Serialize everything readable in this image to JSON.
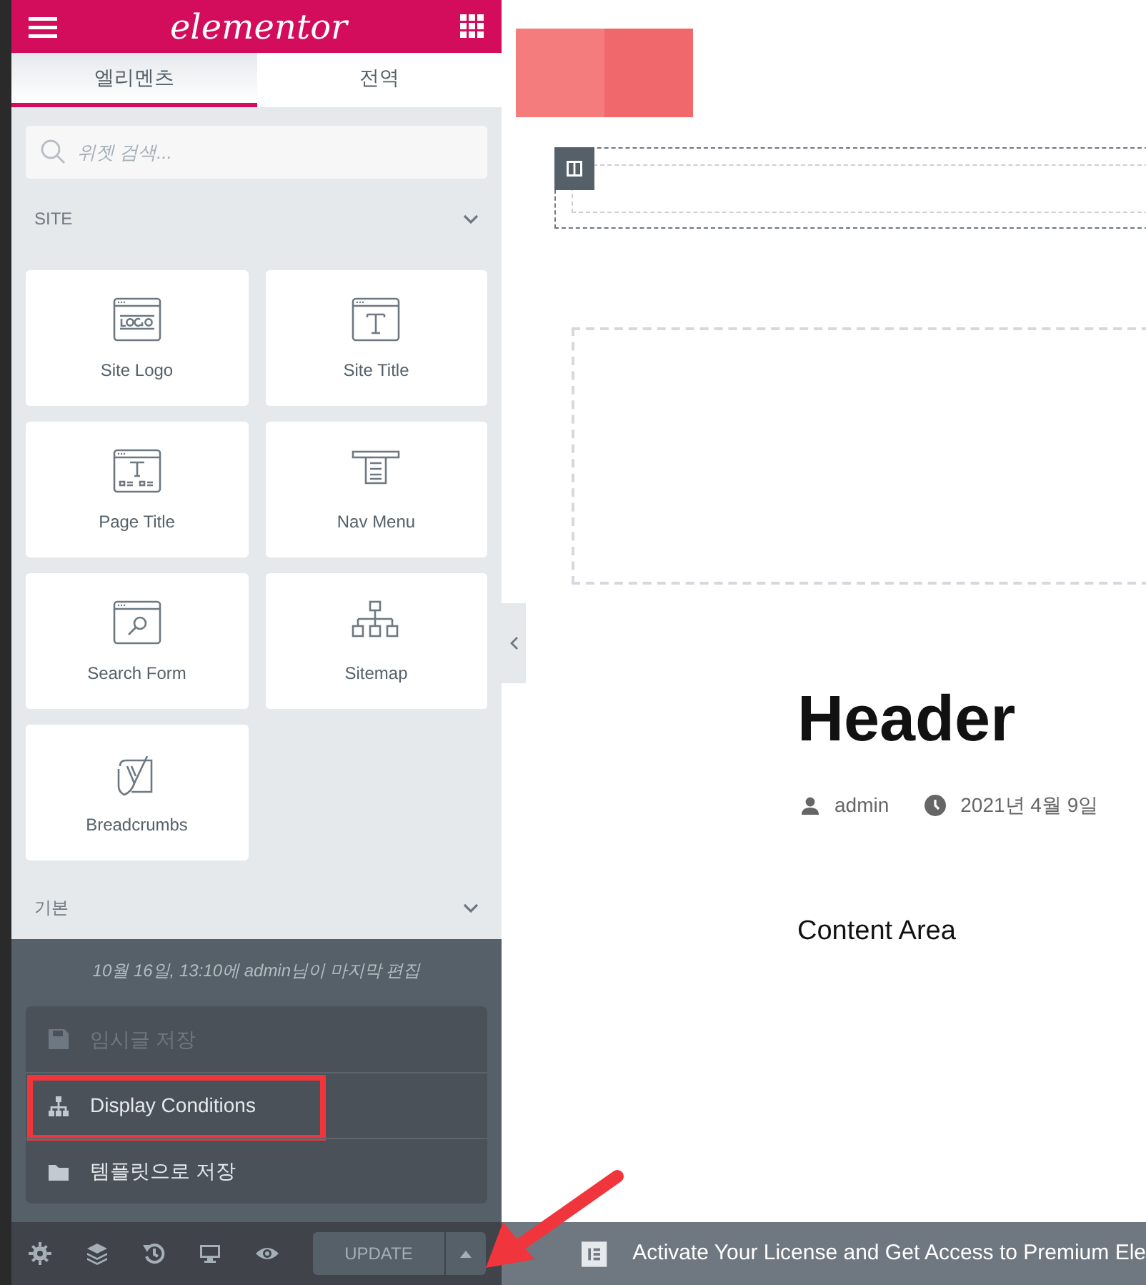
{
  "panel": {
    "logo": "elementor",
    "tabs": [
      {
        "label": "엘리멘츠",
        "selected": true
      },
      {
        "label": "전역",
        "selected": false
      }
    ],
    "search": {
      "placeholder": "위젯 검색..."
    },
    "categories": [
      {
        "title": "SITE",
        "widgets": [
          {
            "label": "Site Logo",
            "kind": "logo"
          },
          {
            "label": "Site Title",
            "kind": "title"
          },
          {
            "label": "Page Title",
            "kind": "page"
          },
          {
            "label": "Nav Menu",
            "kind": "nav"
          },
          {
            "label": "Search Form",
            "kind": "search"
          },
          {
            "label": "Sitemap",
            "kind": "sitemap"
          },
          {
            "label": "Breadcrumbs",
            "kind": "yoast"
          }
        ]
      },
      {
        "title": "기본"
      }
    ],
    "last_edited": "10월 16일, 13:10에 admin님이 마지막 편집",
    "save_menu": [
      {
        "label": "임시글 저장",
        "kind": "save",
        "disabled": true,
        "highlighted": false
      },
      {
        "label": "Display Conditions",
        "kind": "sitemap",
        "disabled": false,
        "highlighted": true
      },
      {
        "label": "템플릿으로 저장",
        "kind": "folder",
        "disabled": false,
        "highlighted": false
      }
    ],
    "footer_tools": [
      {
        "kind": "settings"
      },
      {
        "kind": "layers"
      },
      {
        "kind": "history"
      },
      {
        "kind": "responsive"
      },
      {
        "kind": "preview"
      }
    ],
    "update_button": "UPDATE"
  },
  "canvas": {
    "title": "Header",
    "author": "admin",
    "date": "2021년 4월 9일",
    "content": "Content Area",
    "notice": "Activate Your License and Get Access to Premium Ele"
  }
}
